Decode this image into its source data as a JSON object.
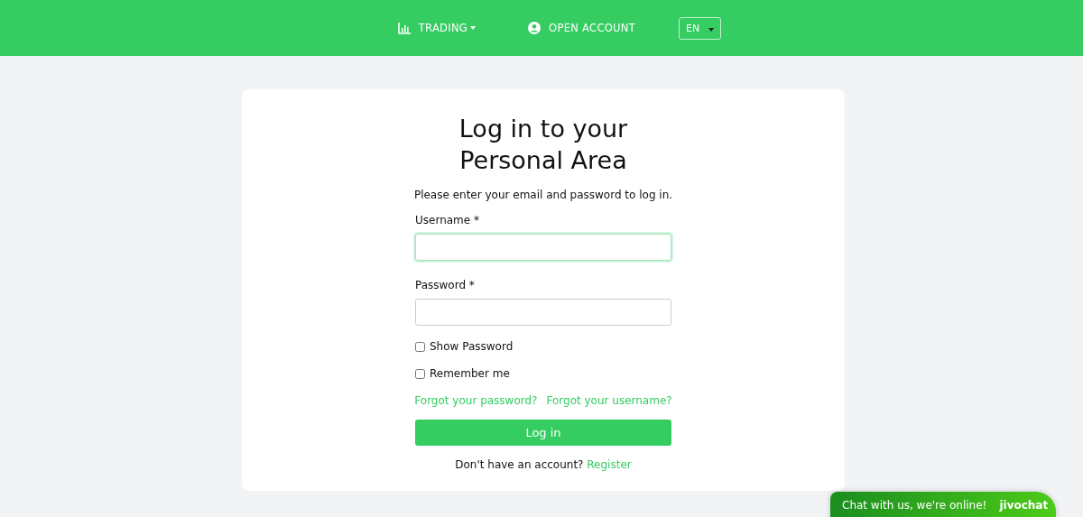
{
  "nav": {
    "items": [
      {
        "kind": "chart",
        "label": "TRADING",
        "dropdown": true
      },
      {
        "kind": "user",
        "label": "OPEN ACCOUNT",
        "dropdown": false
      }
    ],
    "language": "EN"
  },
  "login": {
    "title": "Log in to your Personal Area",
    "subtitle": "Please enter your email and password to log in.",
    "fields": [
      {
        "label": "Username *",
        "focused": true
      },
      {
        "label": "Password *",
        "focused": false
      }
    ],
    "checkboxes": [
      {
        "label": "Show Password",
        "checked": false
      },
      {
        "label": "Remember me",
        "checked": false
      }
    ],
    "links": [
      "Forgot your password?",
      "Forgot your username?"
    ],
    "button": "Log in",
    "register_prompt": "Don't have an account?",
    "register_link": "Register"
  },
  "chat": {
    "text": "Chat with us, we're online!",
    "brand": "jivochat"
  }
}
